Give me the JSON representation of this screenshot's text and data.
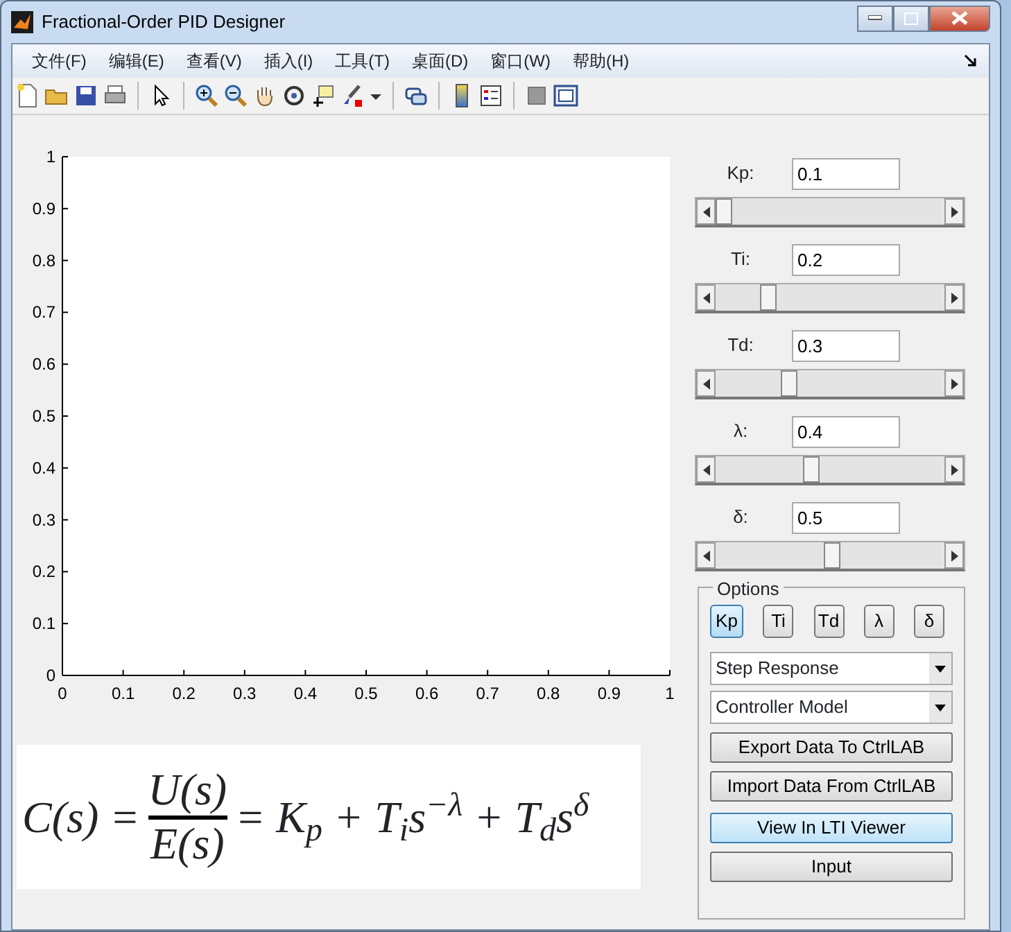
{
  "window": {
    "title": "Fractional-Order PID Designer"
  },
  "menu": [
    "文件(F)",
    "编辑(E)",
    "查看(V)",
    "插入(I)",
    "工具(T)",
    "桌面(D)",
    "窗口(W)",
    "帮助(H)"
  ],
  "chart": {
    "chart_data": {
      "type": "line",
      "xlim": [
        0,
        1
      ],
      "ylim": [
        0,
        1
      ],
      "xticks": [
        {
          "value": 0,
          "label": "0"
        },
        {
          "value": 0.1,
          "label": "0.1"
        },
        {
          "value": 0.2,
          "label": "0.2"
        },
        {
          "value": 0.3,
          "label": "0.3"
        },
        {
          "value": 0.4,
          "label": "0.4"
        },
        {
          "value": 0.5,
          "label": "0.5"
        },
        {
          "value": 0.6,
          "label": "0.6"
        },
        {
          "value": 0.7,
          "label": "0.7"
        },
        {
          "value": 0.8,
          "label": "0.8"
        },
        {
          "value": 0.9,
          "label": "0.9"
        },
        {
          "value": 1,
          "label": "1"
        }
      ],
      "yticks": [
        {
          "value": 0,
          "label": "0"
        },
        {
          "value": 0.1,
          "label": "0.1"
        },
        {
          "value": 0.2,
          "label": "0.2"
        },
        {
          "value": 0.3,
          "label": "0.3"
        },
        {
          "value": 0.4,
          "label": "0.4"
        },
        {
          "value": 0.5,
          "label": "0.5"
        },
        {
          "value": 0.6,
          "label": "0.6"
        },
        {
          "value": 0.7,
          "label": "0.7"
        },
        {
          "value": 0.8,
          "label": "0.8"
        },
        {
          "value": 0.9,
          "label": "0.9"
        },
        {
          "value": 1,
          "label": "1"
        }
      ]
    }
  },
  "formula": {
    "lhs": "C(s) =",
    "numerator": "U(s)",
    "denominator": "E(s)",
    "rhs": "= K$_{p}$ + T$_{i}$s$^{−λ}$ + T$_{d}$s$^{δ}$"
  },
  "parameters": [
    {
      "label": "Kp:",
      "value": "0.1",
      "level": 0
    },
    {
      "label": "Ti:",
      "value": "0.2",
      "level": 0.21
    },
    {
      "label": "Td:",
      "value": "0.3",
      "level": 0.31
    },
    {
      "label": "λ:",
      "value": "0.4",
      "level": 0.41
    },
    {
      "label": "δ:",
      "value": "0.5",
      "level": 0.51
    }
  ],
  "options": {
    "title": "Options",
    "toggles": [
      {
        "label": "Kp",
        "selected": true
      },
      {
        "label": "Ti",
        "selected": false
      },
      {
        "label": "Td",
        "selected": false
      },
      {
        "label": "λ",
        "selected": false
      },
      {
        "label": "δ",
        "selected": false
      }
    ],
    "dropdowns": [
      {
        "value": "Step Response"
      },
      {
        "value": "Controller Model"
      }
    ],
    "buttons": [
      {
        "label": "Export Data To CtrlLAB",
        "highlighted": false
      },
      {
        "label": "Import Data From CtrlLAB",
        "highlighted": false
      },
      {
        "label": "View In LTI Viewer",
        "highlighted": true
      },
      {
        "label": "Input",
        "highlighted": false
      }
    ]
  }
}
